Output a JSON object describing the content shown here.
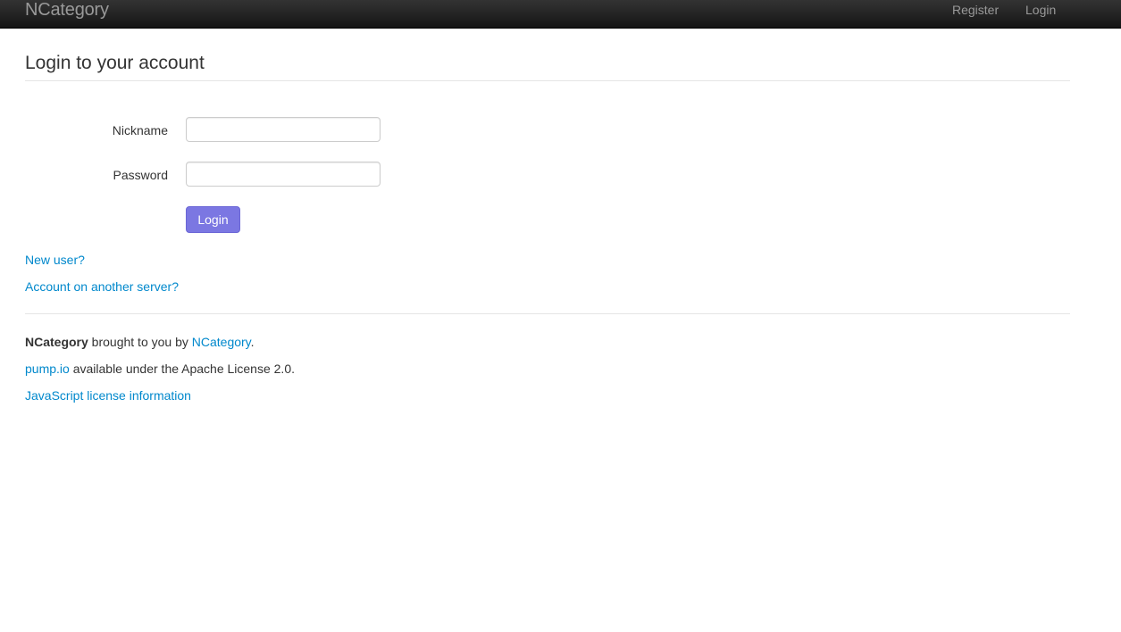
{
  "navbar": {
    "brand": "NCategory",
    "links": {
      "register": "Register",
      "login": "Login"
    }
  },
  "main": {
    "title": "Login to your account",
    "form": {
      "nickname_label": "Nickname",
      "nickname_value": "",
      "password_label": "Password",
      "password_value": "",
      "submit_label": "Login"
    },
    "links": {
      "new_user": "New user?",
      "another_server": "Account on another server?"
    }
  },
  "footer": {
    "line1": {
      "site_name": "NCategory",
      "middle": " brought to you by ",
      "owner_link": "NCategory",
      "end": "."
    },
    "line2": {
      "pump_link": "pump.io",
      "text": " available under the Apache License 2.0."
    },
    "line3": {
      "js_license_link": "JavaScript license information"
    }
  },
  "colors": {
    "navbar_bg": "#1b1b1b",
    "nav_text": "#999999",
    "link": "#0088cc",
    "primary_button": "#7b77e2"
  }
}
